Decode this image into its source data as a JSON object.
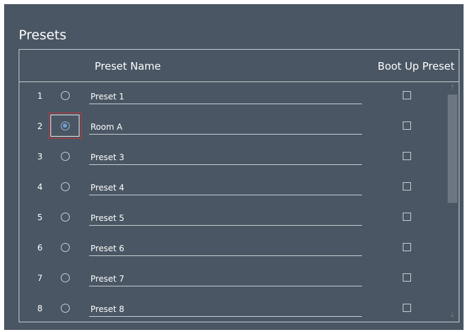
{
  "panel": {
    "title": "Presets"
  },
  "table": {
    "col_name": "Preset Name",
    "col_boot": "Boot Up Preset"
  },
  "rows": [
    {
      "num": "1",
      "name": "Preset 1",
      "selected": false,
      "boot": false
    },
    {
      "num": "2",
      "name": "Room A",
      "selected": true,
      "boot": false
    },
    {
      "num": "3",
      "name": "Preset 3",
      "selected": false,
      "boot": false
    },
    {
      "num": "4",
      "name": "Preset 4",
      "selected": false,
      "boot": false
    },
    {
      "num": "5",
      "name": "Preset 5",
      "selected": false,
      "boot": false
    },
    {
      "num": "6",
      "name": "Preset 6",
      "selected": false,
      "boot": false
    },
    {
      "num": "7",
      "name": "Preset 7",
      "selected": false,
      "boot": false
    },
    {
      "num": "8",
      "name": "Preset 8",
      "selected": false,
      "boot": false
    }
  ],
  "scrollbar": {
    "up_icon": "arrow-up-icon",
    "down_icon": "arrow-down-icon"
  },
  "colors": {
    "panel_bg": "#4a5663",
    "accent": "#6f9fd3",
    "focus": "#c0363a"
  }
}
